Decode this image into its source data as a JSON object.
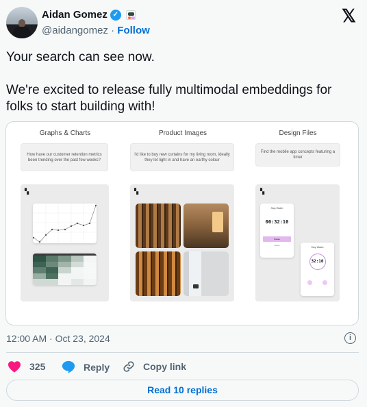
{
  "author": {
    "name": "Aidan Gomez",
    "handle": "@aidangomez",
    "separator": "·",
    "follow_label": "Follow",
    "verified": true
  },
  "tweet": {
    "line1": "Your search can see now.",
    "line2": "We're excited to release fully multimodal embeddings for folks to start building with!"
  },
  "media": {
    "columns": [
      {
        "title": "Graphs & Charts",
        "prompt": "How have our customer retention metrics been trending over the past few weeks?"
      },
      {
        "title": "Product Images",
        "prompt": "I'd like to buy new curtains for my living room, ideally they let light in and have an earthy colour"
      },
      {
        "title": "Design Files",
        "prompt": "Find the mobile app concepts featuring a timer"
      }
    ],
    "design": {
      "card1_title": "Stop Watch",
      "card1_time": "00:32:10",
      "card1_button": "Pause",
      "card1_link": "Reset",
      "card2_title": "Stop Watch",
      "card2_time": "32:10"
    }
  },
  "meta": {
    "timestamp": "12:00 AM · Oct 23, 2024"
  },
  "actions": {
    "likes": "325",
    "reply_label": "Reply",
    "copy_label": "Copy link",
    "like_color": "#f91880",
    "reply_color": "#1d9bf0"
  },
  "read_replies": "Read 10 replies"
}
